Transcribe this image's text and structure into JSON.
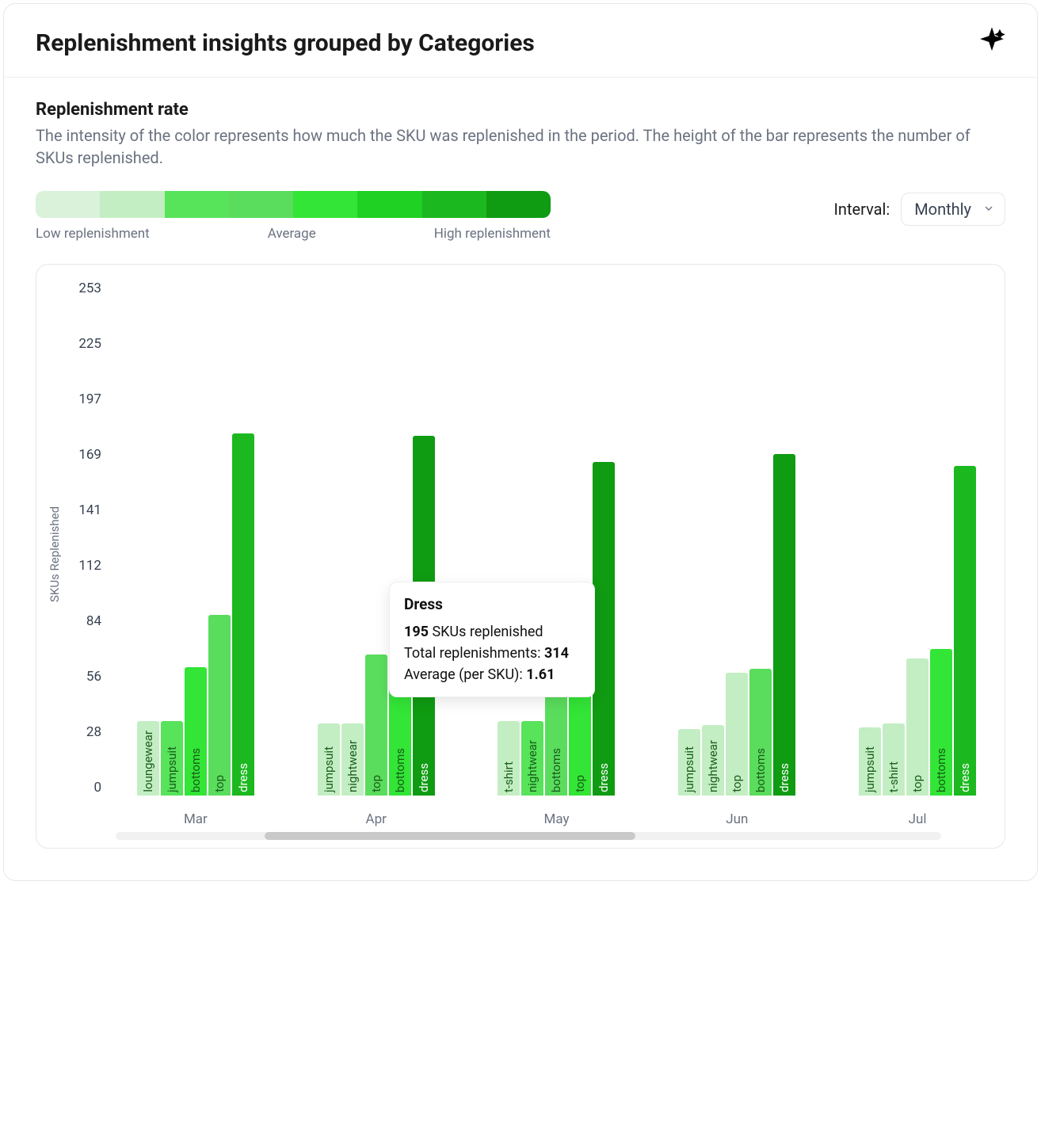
{
  "header": {
    "title": "Replenishment insights grouped by Categories"
  },
  "section": {
    "title": "Replenishment rate",
    "description": "The intensity of the color represents how much the SKU was replenished in the period. The height of the bar represents the number of SKUs replenished."
  },
  "legend": {
    "low": "Low replenishment",
    "mid": "Average",
    "high": "High replenishment",
    "colors": [
      "#d9f2d9",
      "#c3eec3",
      "#57e35a",
      "#5add5d",
      "#32e536",
      "#1ed122",
      "#1cb81f",
      "#0f9b12"
    ]
  },
  "interval": {
    "label": "Interval:",
    "value": "Monthly"
  },
  "tooltip": {
    "title": "Dress",
    "sku_count": "195",
    "sku_suffix": " SKUs replenished",
    "total_label": "Total replenishments: ",
    "total_value": "314",
    "avg_label": "Average (per SKU): ",
    "avg_value": "1.61"
  },
  "chart_data": {
    "type": "bar",
    "ylabel": "SKUs Replenished",
    "ylim": [
      0,
      253
    ],
    "yticks": [
      253,
      225,
      197,
      169,
      141,
      112,
      84,
      56,
      28,
      0
    ],
    "categories": [
      "Mar",
      "Apr",
      "May",
      "Jun",
      "Jul"
    ],
    "intensity_scale_note": "intensity 0..1 maps to legend.colors[0..7]; higher = darker green = more replenished",
    "series_by_month": {
      "Mar": [
        {
          "name": "loungewear",
          "value": 37,
          "intensity": 0.15
        },
        {
          "name": "jumpsuit",
          "value": 37,
          "intensity": 0.3
        },
        {
          "name": "bottoms",
          "value": 64,
          "intensity": 0.5
        },
        {
          "name": "top",
          "value": 90,
          "intensity": 0.45
        },
        {
          "name": "dress",
          "value": 180,
          "intensity": 0.8
        }
      ],
      "Apr": [
        {
          "name": "jumpsuit",
          "value": 36,
          "intensity": 0.15
        },
        {
          "name": "nightwear",
          "value": 36,
          "intensity": 0.2
        },
        {
          "name": "top",
          "value": 70,
          "intensity": 0.4
        },
        {
          "name": "bottoms",
          "value": 74,
          "intensity": 0.55
        },
        {
          "name": "dress",
          "value": 179,
          "intensity": 0.95
        }
      ],
      "May": [
        {
          "name": "t-shirt",
          "value": 37,
          "intensity": 0.1
        },
        {
          "name": "nightwear",
          "value": 37,
          "intensity": 0.25
        },
        {
          "name": "bottoms",
          "value": 64,
          "intensity": 0.45
        },
        {
          "name": "top",
          "value": 72,
          "intensity": 0.55
        },
        {
          "name": "dress",
          "value": 166,
          "intensity": 0.95
        }
      ],
      "Jun": [
        {
          "name": "jumpsuit",
          "value": 33,
          "intensity": 0.1
        },
        {
          "name": "nightwear",
          "value": 35,
          "intensity": 0.1
        },
        {
          "name": "top",
          "value": 61,
          "intensity": 0.15
        },
        {
          "name": "bottoms",
          "value": 63,
          "intensity": 0.45
        },
        {
          "name": "dress",
          "value": 170,
          "intensity": 0.95
        }
      ],
      "Jul": [
        {
          "name": "jumpsuit",
          "value": 34,
          "intensity": 0.1
        },
        {
          "name": "t-shirt",
          "value": 36,
          "intensity": 0.1
        },
        {
          "name": "top",
          "value": 68,
          "intensity": 0.15
        },
        {
          "name": "bottoms",
          "value": 73,
          "intensity": 0.5
        },
        {
          "name": "dress",
          "value": 164,
          "intensity": 0.8
        }
      ]
    }
  }
}
